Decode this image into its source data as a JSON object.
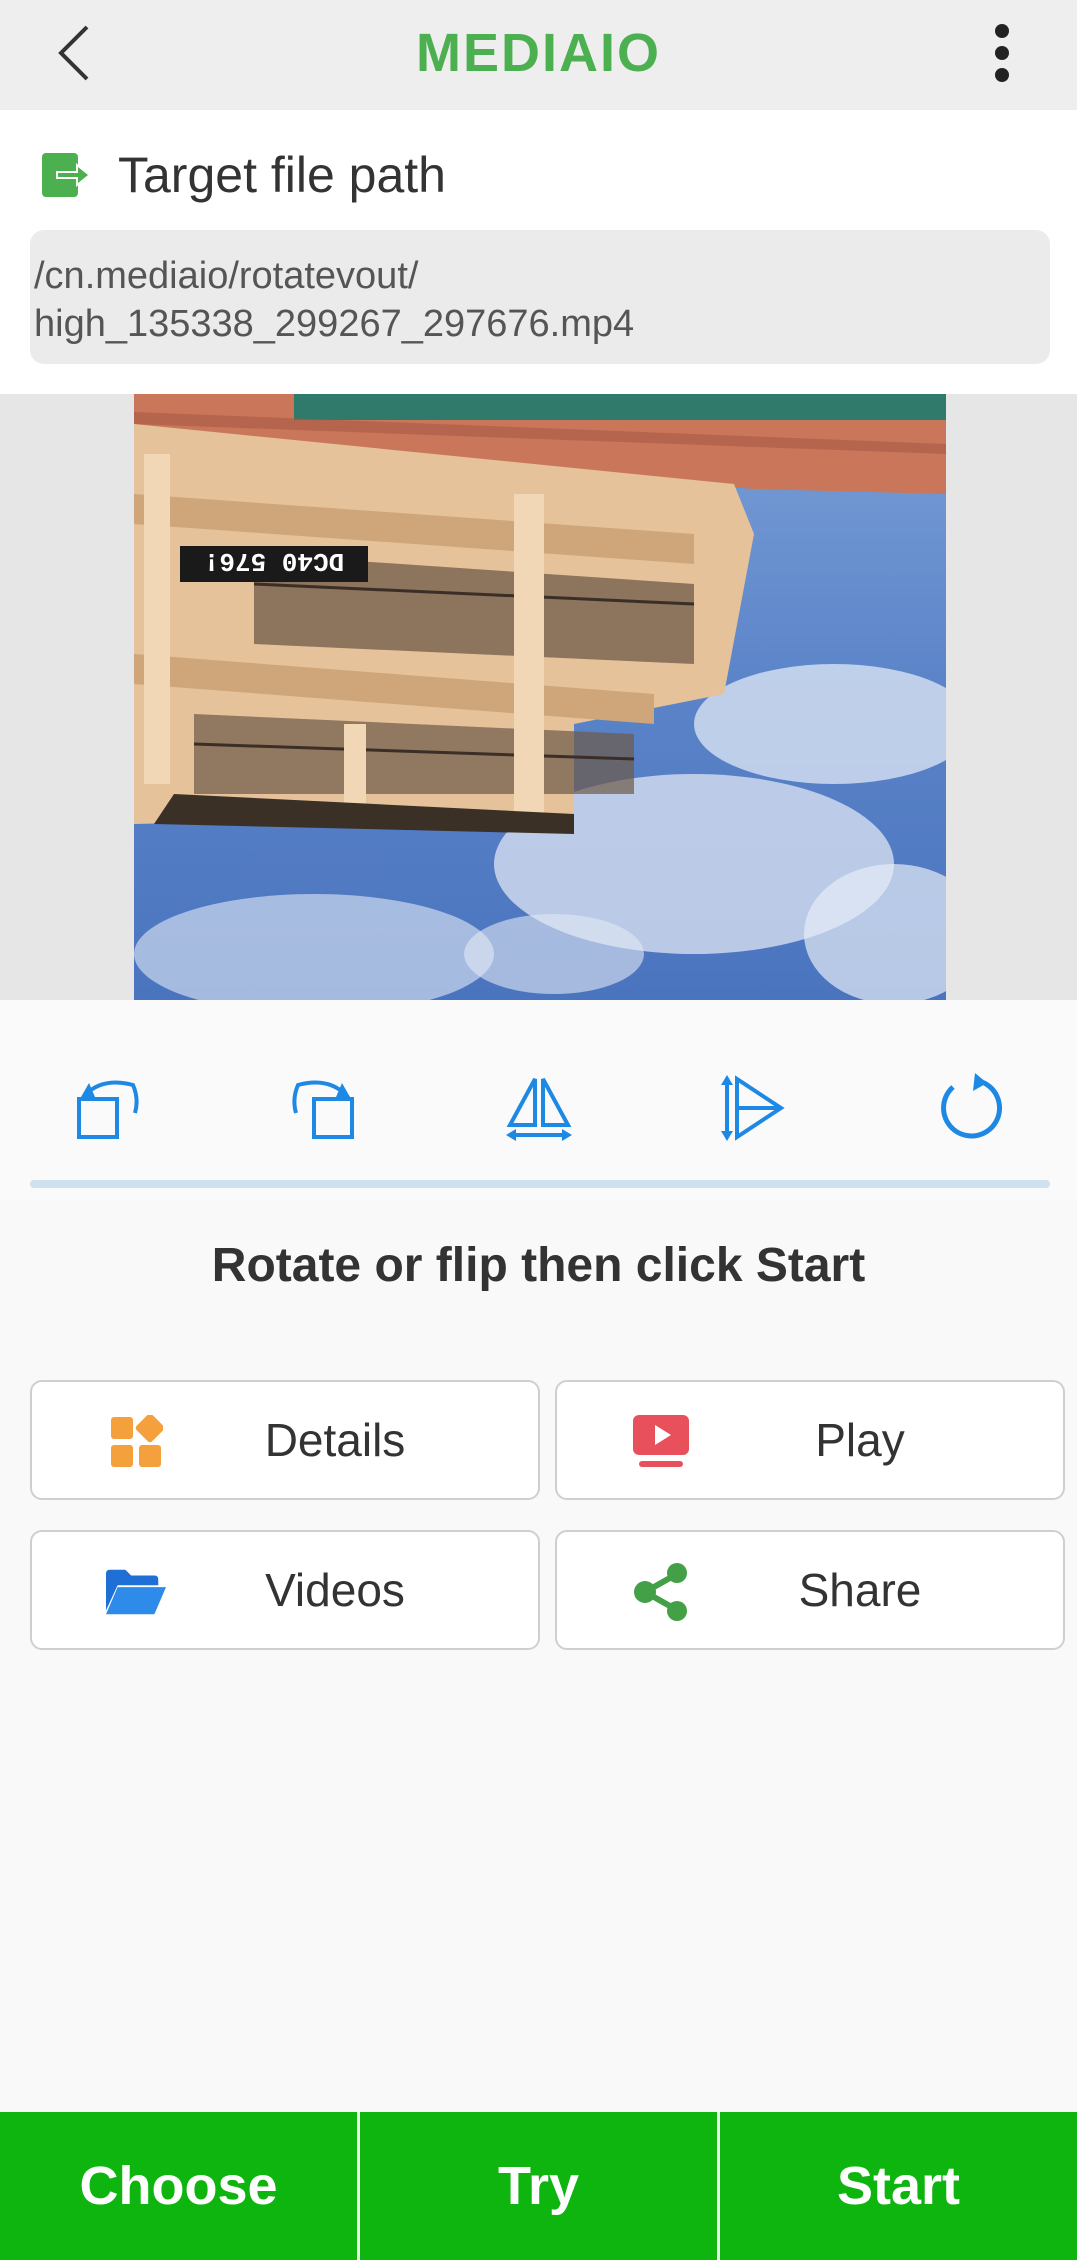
{
  "header": {
    "brand": "MEDIAIO",
    "back_icon": "chevron-left-icon",
    "menu_icon": "more-vertical-icon"
  },
  "target": {
    "title": "Target file path",
    "icon": "export-file-icon",
    "path_line1": "/cn.mediaio/rotatevout/",
    "path_line2": "high_135338_299267_297676.mp4"
  },
  "preview": {
    "overlay_text": "DC40 576!"
  },
  "tools": [
    {
      "name": "rotate-left",
      "icon": "rotate-left-icon"
    },
    {
      "name": "rotate-right",
      "icon": "rotate-right-icon"
    },
    {
      "name": "flip-horizontal",
      "icon": "flip-horizontal-icon"
    },
    {
      "name": "flip-vertical",
      "icon": "flip-vertical-icon"
    },
    {
      "name": "reset",
      "icon": "reset-icon"
    }
  ],
  "hint": "Rotate or flip then click Start",
  "actions": {
    "details": "Details",
    "play": "Play",
    "videos": "Videos",
    "share": "Share"
  },
  "bottom": {
    "choose": "Choose",
    "try": "Try",
    "start": "Start"
  },
  "colors": {
    "brand": "#4caf50",
    "accent": "#1e88e5",
    "bottom_bar": "#0eb50e",
    "details_icon": "#f4a03d",
    "play_icon": "#e8505b",
    "share_icon": "#43a047"
  }
}
